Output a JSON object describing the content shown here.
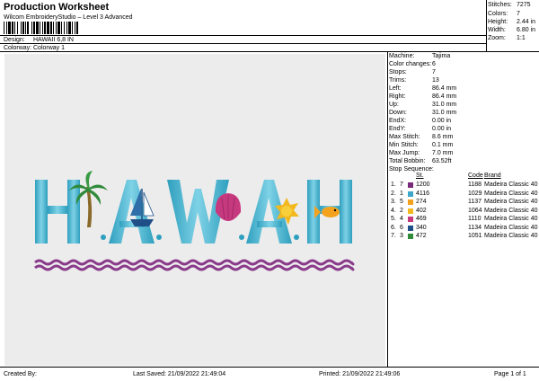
{
  "header": {
    "title": "Production Worksheet",
    "subtitle": "Wilcom EmbroideryStudio – Level 3 Advanced",
    "barcode_icon": "barcode-icon"
  },
  "meta": {
    "design_label": "Design:",
    "design_value": "HAWAII 6,8 IN",
    "colorway_label": "Colorway:",
    "colorway_value": "Colorway 1"
  },
  "summary": {
    "stitches_label": "Stitches:",
    "stitches_value": "7275",
    "colors_label": "Colors:",
    "colors_value": "7",
    "height_label": "Height:",
    "height_value": "2.44 in",
    "width_label": "Width:",
    "width_value": "6.80 in",
    "zoom_label": "Zoom:",
    "zoom_value": "1:1"
  },
  "machine": [
    {
      "label": "Machine:",
      "value": "Tajima"
    },
    {
      "label": "Color changes:",
      "value": "6"
    },
    {
      "label": "Stops:",
      "value": "7"
    },
    {
      "label": "Trims:",
      "value": "13"
    },
    {
      "label": "Left:",
      "value": "86.4 mm"
    },
    {
      "label": "Right:",
      "value": "86.4 mm"
    },
    {
      "label": "Up:",
      "value": "31.0 mm"
    },
    {
      "label": "Down:",
      "value": "31.0 mm"
    },
    {
      "label": "EndX:",
      "value": "0.00 in"
    },
    {
      "label": "EndY:",
      "value": "0.00 in"
    },
    {
      "label": "Max Stitch:",
      "value": "8.6 mm"
    },
    {
      "label": "Min Stitch:",
      "value": "0.1 mm"
    },
    {
      "label": "Max Jump:",
      "value": "7.0 mm"
    },
    {
      "label": "Total Bobbin:",
      "value": "63.52ft"
    }
  ],
  "stop_sequence": {
    "title": "Stop Sequence:",
    "headers": {
      "st": "St.",
      "code": "Code",
      "brand": "Brand"
    },
    "rows": [
      {
        "n": "1.",
        "c": "7",
        "color": "#7a2a7a",
        "st": "1200",
        "code": "1188",
        "brand": "Madeira Classic 40"
      },
      {
        "n": "2.",
        "c": "1",
        "color": "#3ea6c8",
        "st": "4116",
        "code": "1029",
        "brand": "Madeira Classic 40"
      },
      {
        "n": "3.",
        "c": "5",
        "color": "#f4a21e",
        "st": "274",
        "code": "1137",
        "brand": "Madeira Classic 40"
      },
      {
        "n": "4.",
        "c": "2",
        "color": "#f2b81e",
        "st": "402",
        "code": "1064",
        "brand": "Madeira Classic 40"
      },
      {
        "n": "5.",
        "c": "4",
        "color": "#c7397f",
        "st": "469",
        "code": "1110",
        "brand": "Madeira Classic 40"
      },
      {
        "n": "6.",
        "c": "6",
        "color": "#1f4f86",
        "st": "340",
        "code": "1134",
        "brand": "Madeira Classic 40"
      },
      {
        "n": "7.",
        "c": "3",
        "color": "#2f8a3a",
        "st": "472",
        "code": "1051",
        "brand": "Madeira Classic 40"
      }
    ]
  },
  "footer": {
    "created": "Created By:",
    "saved": "Last Saved: 21/09/2022 21:49:04",
    "printed": "Printed: 21/09/2022 21:49:06",
    "page": "Page 1 of 1"
  },
  "design": {
    "letters": [
      "H",
      "A",
      "W",
      "A",
      "I",
      "I"
    ],
    "letter_color": "#4ab6cf",
    "wave_color": "#8a3a8a",
    "icons": [
      "palm-tree-icon",
      "sailboat-icon",
      "seashell-icon",
      "sun-icon",
      "fish-icon"
    ]
  }
}
